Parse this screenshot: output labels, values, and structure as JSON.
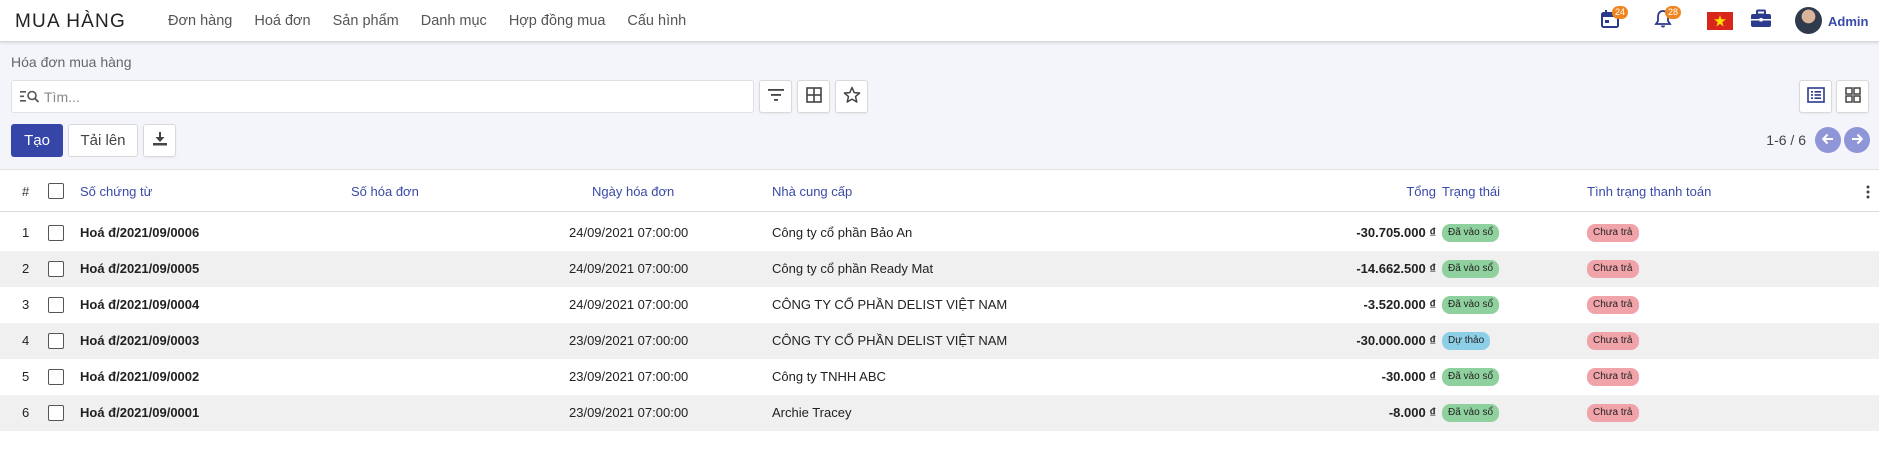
{
  "app": {
    "title": "MUA HÀNG"
  },
  "topnav": [
    "Đơn hàng",
    "Hoá đơn",
    "Sản phẩm",
    "Danh mục",
    "Hợp đồng mua",
    "Cấu hình"
  ],
  "topright": {
    "calendar_badge": "24",
    "bell_badge": "28",
    "user_name": "Admin"
  },
  "breadcrumb": "Hóa đơn mua hàng",
  "search": {
    "placeholder": "Tìm..."
  },
  "actions": {
    "create": "Tạo",
    "upload": "Tải lên"
  },
  "pager": "1-6 / 6",
  "columns": {
    "num": "#",
    "voucher": "Số chứng từ",
    "invoice_no": "Số hóa đơn",
    "invoice_date": "Ngày hóa đơn",
    "supplier": "Nhà cung cấp",
    "total": "Tổng",
    "status": "Trạng thái",
    "payment": "Tình trạng thanh toán"
  },
  "rows": [
    {
      "n": "1",
      "voucher": "Hoá đ/2021/09/0006",
      "date": "24/09/2021 07:00:00",
      "supplier": "Công ty cổ phần Bảo An",
      "total": "-30.705.000 ₫",
      "status": "Đã vào sổ",
      "payment": "Chưa trả"
    },
    {
      "n": "2",
      "voucher": "Hoá đ/2021/09/0005",
      "date": "24/09/2021 07:00:00",
      "supplier": "Công ty cổ phần Ready Mat",
      "total": "-14.662.500 ₫",
      "status": "Đã vào sổ",
      "payment": "Chưa trả"
    },
    {
      "n": "3",
      "voucher": "Hoá đ/2021/09/0004",
      "date": "24/09/2021 07:00:00",
      "supplier": "CÔNG TY CỔ PHẦN DELIST VIỆT NAM",
      "total": "-3.520.000 ₫",
      "status": "Đã vào sổ",
      "payment": "Chưa trả"
    },
    {
      "n": "4",
      "voucher": "Hoá đ/2021/09/0003",
      "date": "23/09/2021 07:00:00",
      "supplier": "CÔNG TY CỔ PHẦN DELIST VIỆT NAM",
      "total": "-30.000.000 ₫",
      "status": "Dự thảo",
      "payment": "Chưa trả"
    },
    {
      "n": "5",
      "voucher": "Hoá đ/2021/09/0002",
      "date": "23/09/2021 07:00:00",
      "supplier": "Công ty TNHH ABC",
      "total": "-30.000 ₫",
      "status": "Đã vào sổ",
      "payment": "Chưa trả"
    },
    {
      "n": "6",
      "voucher": "Hoá đ/2021/09/0001",
      "date": "23/09/2021 07:00:00",
      "supplier": "Archie Tracey",
      "total": "-8.000 ₫",
      "status": "Đã vào sổ",
      "payment": "Chưa trả"
    }
  ],
  "colors": {
    "primary": "#3545a8",
    "link": "#3a4aa8",
    "status_posted": "#8fd19e",
    "status_draft": "#8ecfe8",
    "payment_unpaid": "#f0a3a8",
    "badge": "#f0851f"
  },
  "icons": [
    "search-icon",
    "filter-icon",
    "group-by-icon",
    "favorite-star-icon",
    "download-icon",
    "list-view-icon",
    "kanban-view-icon",
    "calendar-icon",
    "bell-icon",
    "vietnam-flag-icon",
    "briefcase-icon",
    "arrow-left-icon",
    "arrow-right-icon",
    "more-options-icon"
  ]
}
